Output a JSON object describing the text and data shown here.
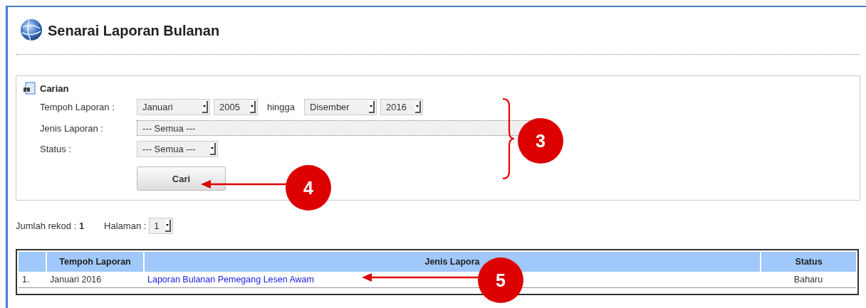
{
  "page": {
    "title": "Senarai Laporan Bulanan"
  },
  "search": {
    "title": "Carian",
    "period": {
      "label": "Tempoh Laporan :",
      "from_month": "Januari",
      "from_year": "2005",
      "separator": "hingga",
      "to_month": "Disember",
      "to_year": "2016"
    },
    "type": {
      "label": "Jenis Laporan :",
      "value": "--- Semua ---"
    },
    "status": {
      "label": "Status :",
      "value": "--- Semua ---"
    },
    "button": "Cari"
  },
  "summary": {
    "records_label": "Jumlah rekod :",
    "records": "1",
    "page_label": "Halaman :",
    "page": "1"
  },
  "table": {
    "columns": [
      "",
      "Tempoh Laporan",
      "Jenis Lapora",
      "Status"
    ],
    "rows": [
      {
        "no": "1.",
        "period": "Januari 2016",
        "type": "Laporan Bulanan Pemegang Lesen Awam",
        "status": "Baharu"
      }
    ]
  },
  "annotations": [
    "3",
    "4",
    "5"
  ]
}
